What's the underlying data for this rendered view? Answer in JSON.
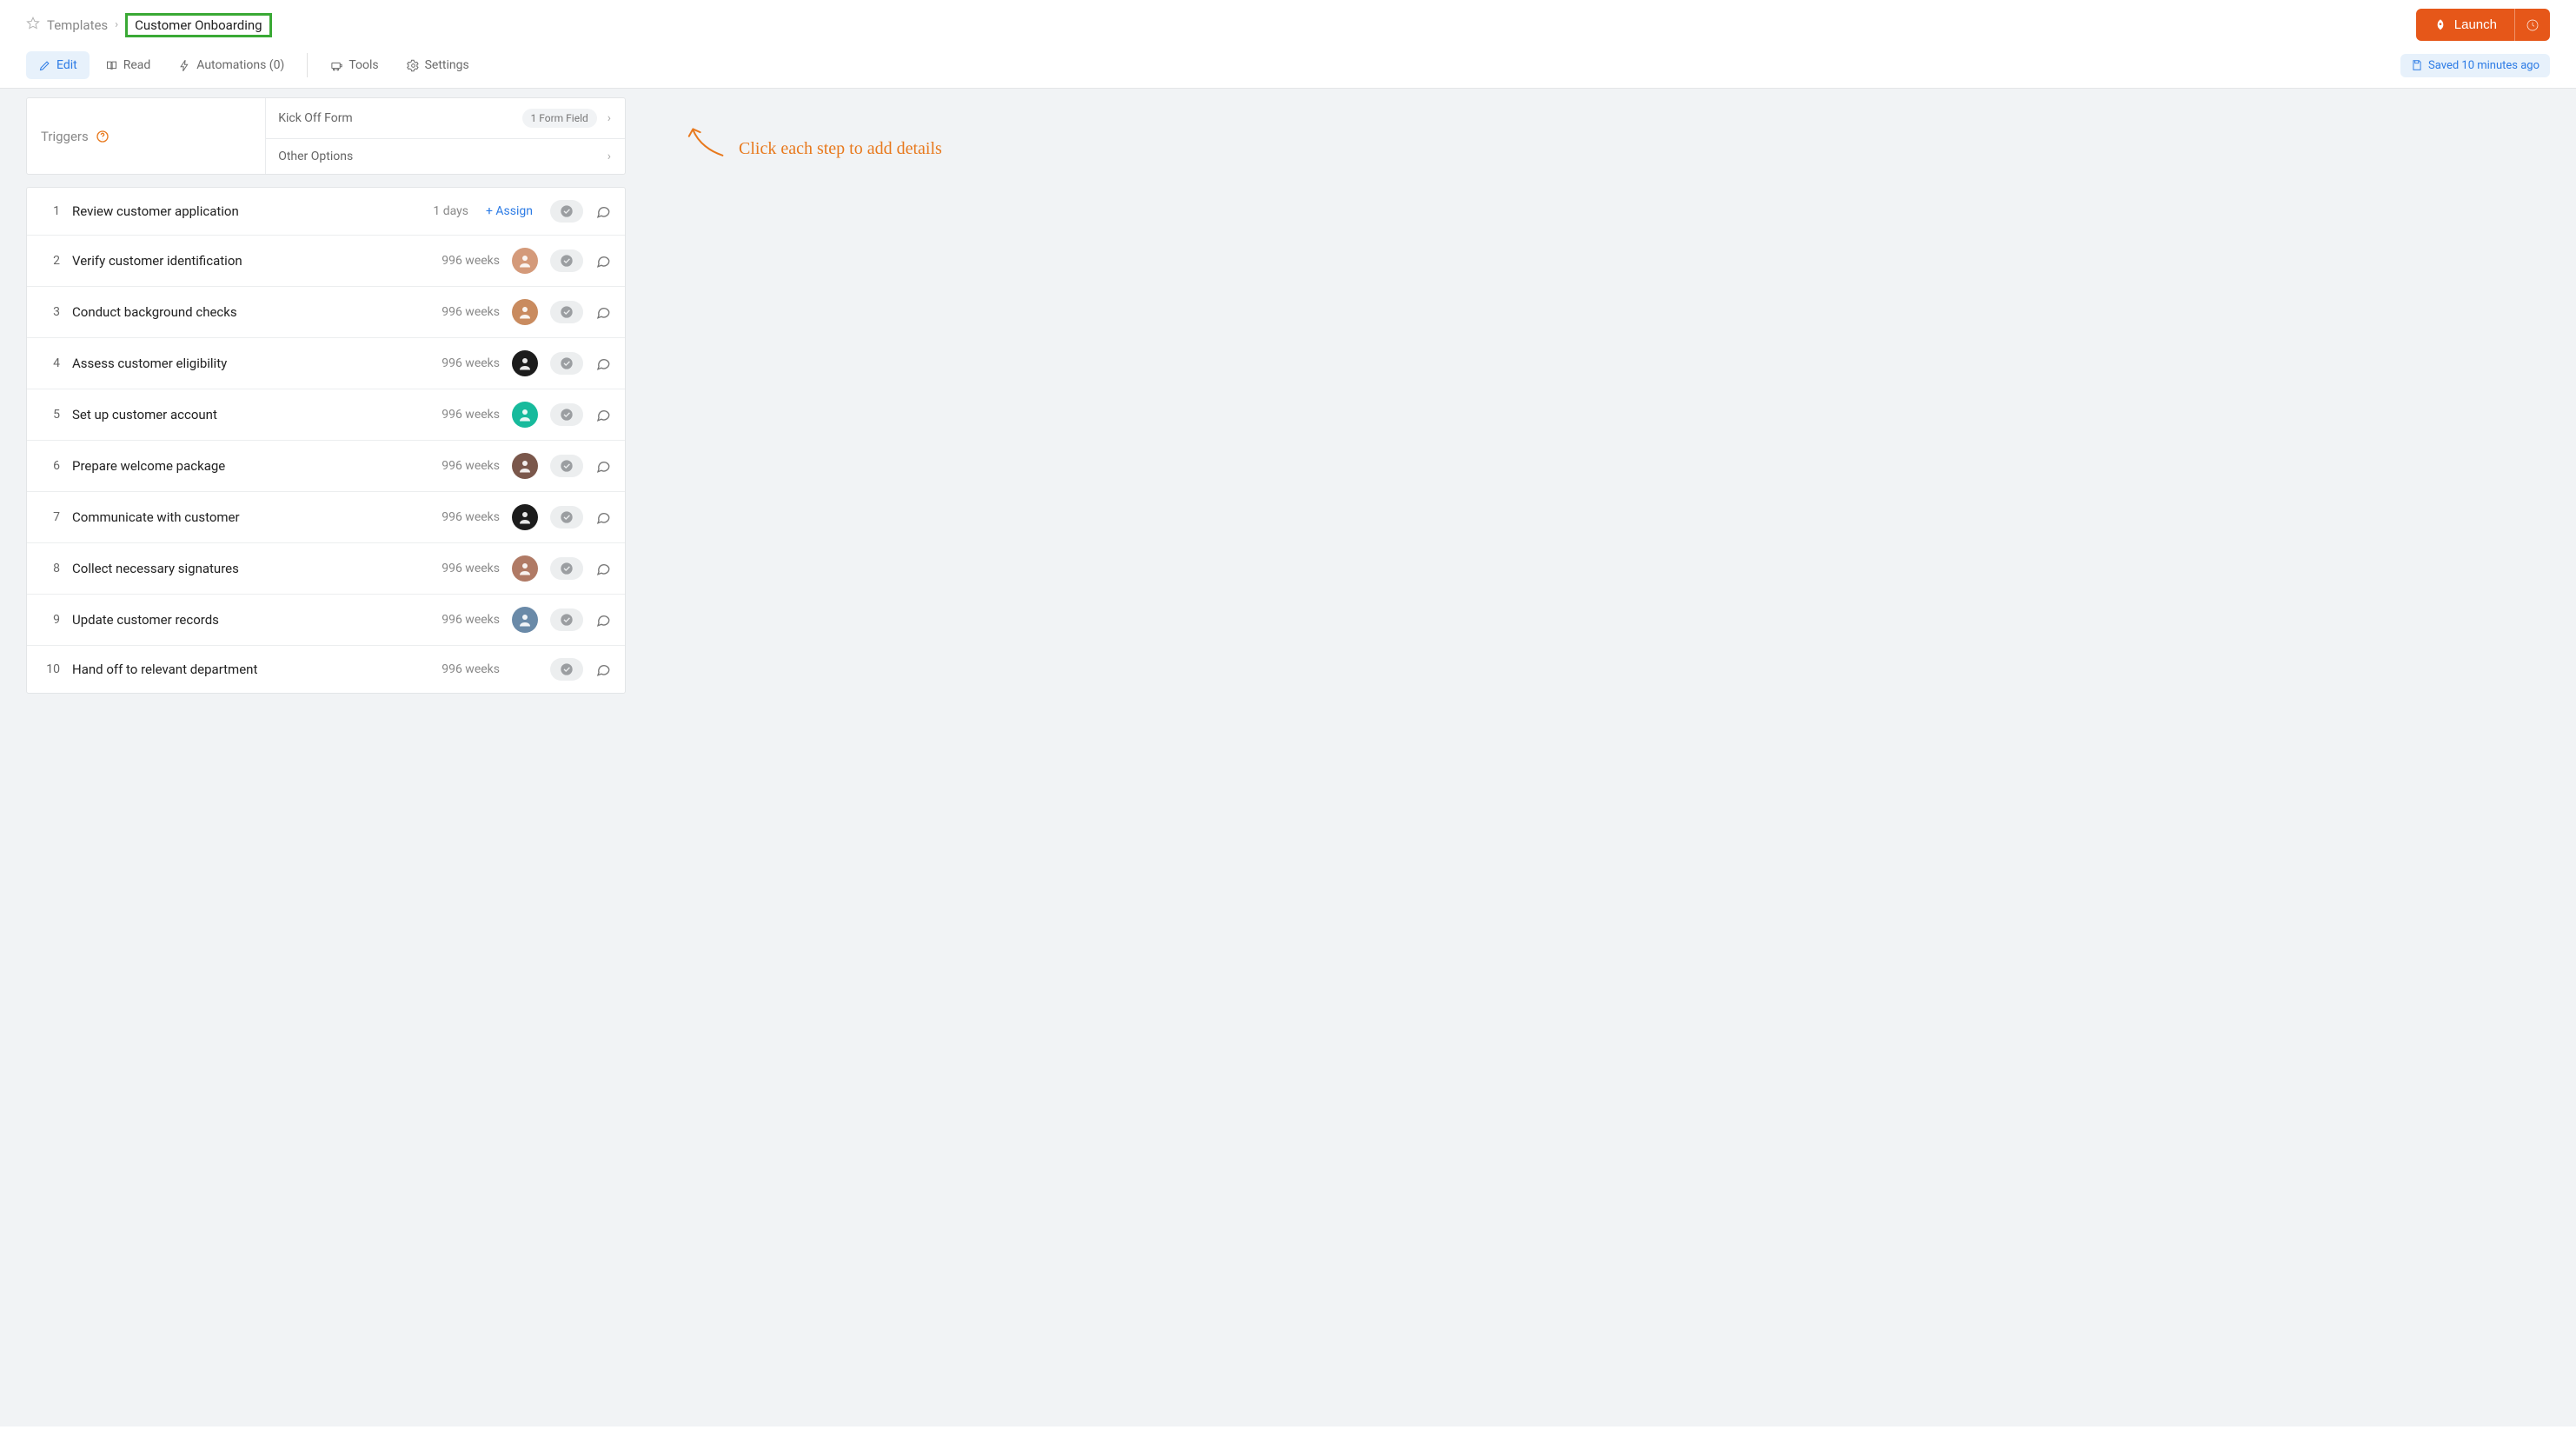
{
  "breadcrumb": {
    "root": "Templates",
    "current": "Customer Onboarding"
  },
  "launch": {
    "label": "Launch"
  },
  "tabs": {
    "edit": "Edit",
    "read": "Read",
    "automations": "Automations (0)",
    "tools": "Tools",
    "settings": "Settings"
  },
  "saved_status": "Saved 10 minutes ago",
  "triggers": {
    "label": "Triggers",
    "kick_off": "Kick Off Form",
    "form_pill": "1 Form Field",
    "other": "Other Options"
  },
  "assign_label": "+ Assign",
  "hint_text": "Click each step to add details",
  "avatar_colors": [
    "#d49a7a",
    "#c98b5f",
    "#1c1c1c",
    "#17ba9c",
    "#7a574b",
    "#1c1c1c",
    "#b07a65",
    "#6a8aa8",
    "#bdbdbd"
  ],
  "steps": [
    {
      "n": "1",
      "title": "Review customer application",
      "due": "1 days",
      "assignee": null
    },
    {
      "n": "2",
      "title": "Verify customer identification",
      "due": "996 weeks",
      "assignee": "A"
    },
    {
      "n": "3",
      "title": "Conduct background checks",
      "due": "996 weeks",
      "assignee": "B"
    },
    {
      "n": "4",
      "title": "Assess customer eligibility",
      "due": "996 weeks",
      "assignee": "C"
    },
    {
      "n": "5",
      "title": "Set up customer account",
      "due": "996 weeks",
      "assignee": "D"
    },
    {
      "n": "6",
      "title": "Prepare welcome package",
      "due": "996 weeks",
      "assignee": "E"
    },
    {
      "n": "7",
      "title": "Communicate with customer",
      "due": "996 weeks",
      "assignee": "F"
    },
    {
      "n": "8",
      "title": "Collect necessary signatures",
      "due": "996 weeks",
      "assignee": "G"
    },
    {
      "n": "9",
      "title": "Update customer records",
      "due": "996 weeks",
      "assignee": "H"
    },
    {
      "n": "10",
      "title": "Hand off to relevant department",
      "due": "996 weeks",
      "assignee": null
    }
  ]
}
